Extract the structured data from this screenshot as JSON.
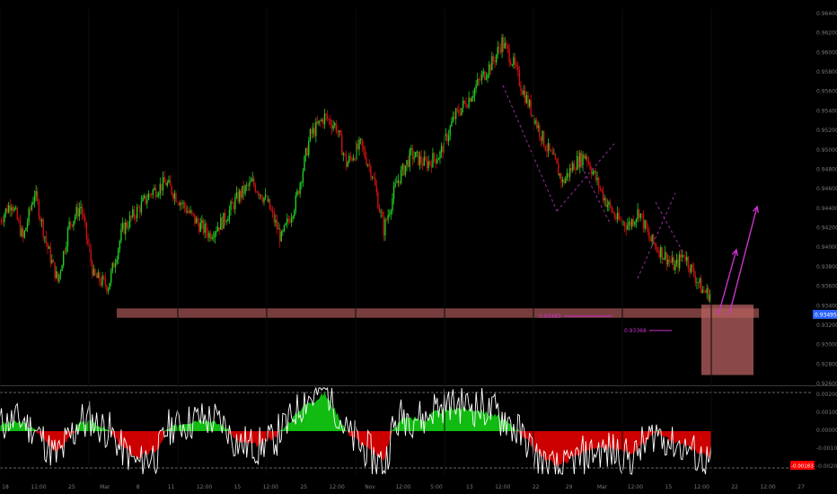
{
  "theme": {
    "background": "#000000",
    "bull": "#22cc22",
    "bear": "#cc1111",
    "osc_pos": "#11bb11",
    "osc_neg": "#cc0000",
    "osc_line": "#ffffff",
    "zone": "#b86060",
    "projection": "#cc33cc",
    "pattern": "#9a2a9a",
    "price_tag": "#2962ff",
    "ind_tag": "#ff0000"
  },
  "chart_data": [
    {
      "type": "candlestick",
      "title": "",
      "x_tick_labels": [
        "18",
        "11:00",
        "25",
        "Mar",
        "8",
        "11",
        "12:00",
        "15",
        "12:00",
        "25",
        "12:00",
        "Nov",
        "12:00",
        "5:00",
        "13",
        "12:00",
        "22",
        "29",
        "Mar",
        "12:00",
        "15",
        "12:00",
        "22",
        "12:00",
        "27"
      ],
      "y_tick_labels": [
        "0.96400",
        "0.96200",
        "0.96000",
        "0.95800",
        "0.95600",
        "0.95400",
        "0.95200",
        "0.95000",
        "0.94800",
        "0.94600",
        "0.94400",
        "0.94200",
        "0.94000",
        "0.93800",
        "0.93600",
        "0.93400",
        "0.93200",
        "0.93000",
        "0.92800",
        "0.92600"
      ],
      "ylim": [
        0.9255,
        0.9655
      ],
      "support_zone": [
        0.9326,
        0.9336
      ],
      "demand_box": [
        0.9265,
        0.934
      ],
      "current_price_label": "0.93495",
      "level_labels": [
        "0.93483",
        "0.93368"
      ],
      "waypoints": [
        [
          0,
          0.943
        ],
        [
          8,
          0.945
        ],
        [
          16,
          0.941
        ],
        [
          24,
          0.946
        ],
        [
          33,
          0.94
        ],
        [
          40,
          0.9365
        ],
        [
          48,
          0.9425
        ],
        [
          56,
          0.9445
        ],
        [
          65,
          0.937
        ],
        [
          75,
          0.936
        ],
        [
          85,
          0.942
        ],
        [
          95,
          0.944
        ],
        [
          105,
          0.946
        ],
        [
          115,
          0.947
        ],
        [
          125,
          0.945
        ],
        [
          135,
          0.943
        ],
        [
          145,
          0.9415
        ],
        [
          155,
          0.943
        ],
        [
          165,
          0.9455
        ],
        [
          175,
          0.947
        ],
        [
          185,
          0.945
        ],
        [
          195,
          0.941
        ],
        [
          205,
          0.945
        ],
        [
          215,
          0.952
        ],
        [
          225,
          0.954
        ],
        [
          233,
          0.953
        ],
        [
          240,
          0.949
        ],
        [
          250,
          0.951
        ],
        [
          258,
          0.948
        ],
        [
          266,
          0.942
        ],
        [
          275,
          0.947
        ],
        [
          285,
          0.95
        ],
        [
          295,
          0.949
        ],
        [
          305,
          0.95
        ],
        [
          315,
          0.954
        ],
        [
          325,
          0.956
        ],
        [
          333,
          0.958
        ],
        [
          342,
          0.96
        ],
        [
          348,
          0.962
        ],
        [
          355,
          0.96
        ],
        [
          362,
          0.957
        ],
        [
          370,
          0.954
        ],
        [
          378,
          0.951
        ],
        [
          385,
          0.949
        ],
        [
          390,
          0.947
        ],
        [
          398,
          0.949
        ],
        [
          406,
          0.95
        ],
        [
          414,
          0.947
        ],
        [
          420,
          0.945
        ],
        [
          428,
          0.943
        ],
        [
          436,
          0.9425
        ],
        [
          443,
          0.944
        ],
        [
          450,
          0.941
        ],
        [
          456,
          0.94
        ],
        [
          462,
          0.939
        ],
        [
          468,
          0.938
        ],
        [
          474,
          0.9395
        ],
        [
          480,
          0.9375
        ],
        [
          487,
          0.9355
        ],
        [
          493,
          0.935
        ]
      ],
      "seed": 7
    },
    {
      "type": "area",
      "title": "",
      "label": "",
      "y_tick_labels": [
        "0.00200",
        "0.00100",
        "0.00000",
        "-0.00100",
        "-0.00200"
      ],
      "ylim": [
        -0.0024,
        0.0024
      ],
      "value_tag": "-0.00183",
      "histogram_knots": [
        [
          0,
          0.0004
        ],
        [
          15,
          0.0005
        ],
        [
          25,
          0.0
        ],
        [
          40,
          -0.0012
        ],
        [
          55,
          0.0004
        ],
        [
          65,
          0.0005
        ],
        [
          75,
          0.0
        ],
        [
          85,
          -0.0009
        ],
        [
          95,
          -0.0015
        ],
        [
          110,
          -0.001
        ],
        [
          115,
          0.0
        ],
        [
          125,
          0.0004
        ],
        [
          140,
          0.0007
        ],
        [
          155,
          0.0003
        ],
        [
          165,
          -0.0006
        ],
        [
          180,
          -0.0008
        ],
        [
          190,
          -0.0003
        ],
        [
          195,
          0.0
        ],
        [
          210,
          0.0014
        ],
        [
          220,
          0.0018
        ],
        [
          225,
          0.0021
        ],
        [
          235,
          0.0008
        ],
        [
          240,
          0.0
        ],
        [
          255,
          -0.001
        ],
        [
          266,
          -0.0016
        ],
        [
          272,
          0.0
        ],
        [
          280,
          0.0008
        ],
        [
          295,
          0.0006
        ],
        [
          300,
          0.001
        ],
        [
          315,
          0.0013
        ],
        [
          330,
          0.0012
        ],
        [
          345,
          0.0008
        ],
        [
          360,
          0.0
        ],
        [
          368,
          -0.0008
        ],
        [
          378,
          -0.0016
        ],
        [
          388,
          -0.0019
        ],
        [
          400,
          -0.0013
        ],
        [
          410,
          -0.001
        ],
        [
          425,
          -0.001
        ],
        [
          440,
          -0.0012
        ],
        [
          455,
          0.0
        ],
        [
          460,
          -0.0004
        ],
        [
          475,
          -0.0008
        ],
        [
          485,
          -0.0012
        ],
        [
          493,
          -0.0014
        ]
      ],
      "seed": 3
    }
  ]
}
